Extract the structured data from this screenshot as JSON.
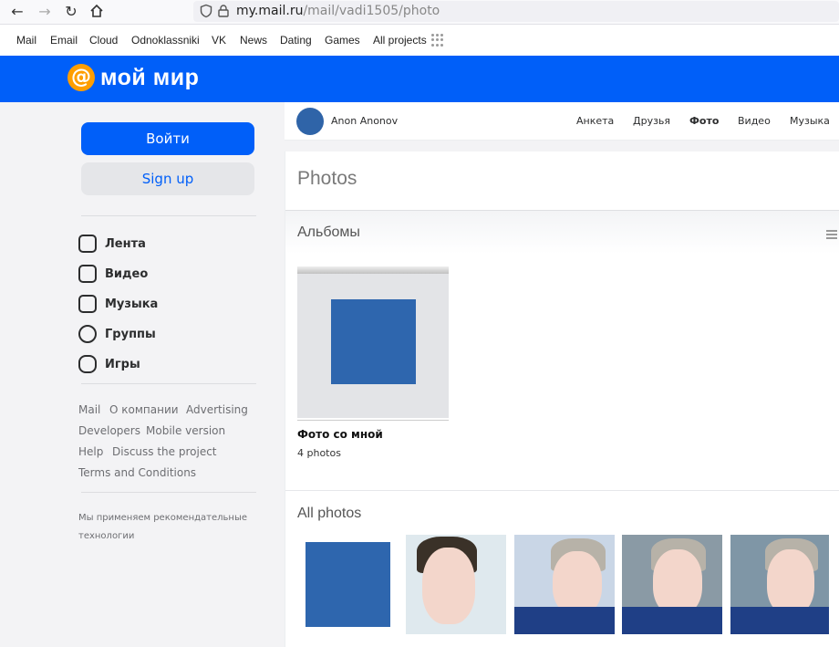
{
  "browser": {
    "url_host": "my.mail.ru",
    "url_path": "/mail/vadi1505/photo"
  },
  "portal_nav": [
    "Mail",
    "Email",
    "Cloud",
    "Odnoklassniki",
    "VK",
    "News",
    "Dating",
    "Games",
    "All projects"
  ],
  "brand": {
    "symbol": "@",
    "name": "мой мир",
    "color": "#005ff9",
    "logo_color": "#ff9e00"
  },
  "sidebar": {
    "login_label": "Войти",
    "signup_label": "Sign up",
    "menu": [
      {
        "label": "Лента",
        "icon": "feed-icon"
      },
      {
        "label": "Видео",
        "icon": "video-icon"
      },
      {
        "label": "Музыка",
        "icon": "music-icon"
      },
      {
        "label": "Группы",
        "icon": "groups-icon"
      },
      {
        "label": "Игры",
        "icon": "gamepad-icon"
      }
    ],
    "footer_links": [
      "Mail",
      "О компании",
      "Advertising",
      "Developers",
      "Mobile version",
      "Help",
      "Discuss the project",
      "Terms and Conditions"
    ],
    "disclaimer_line1": "Мы применяем рекомендательные",
    "disclaimer_line2": "технологии"
  },
  "profile": {
    "name": "Anon Anonov",
    "tabs": [
      "Анкета",
      "Друзья",
      "Фото",
      "Видео",
      "Музыка"
    ],
    "active_tab": "Фото"
  },
  "main": {
    "title": "Photos",
    "albums_heading": "Альбомы",
    "album": {
      "name": "Фото со мной",
      "count": "4 photos"
    },
    "all_photos_heading": "All photos"
  }
}
